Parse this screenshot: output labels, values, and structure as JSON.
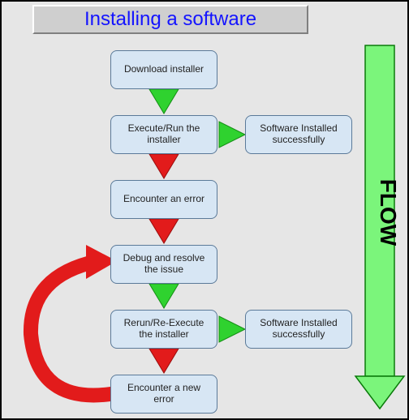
{
  "title": "Installing a software",
  "flow_label": "FLOW",
  "nodes": {
    "download": "Download installer",
    "execute": "Execute/Run the installer",
    "success1": "Software Installed successfully",
    "error1": "Encounter an error",
    "debug": "Debug and resolve the issue",
    "rerun": "Rerun/Re-Execute the installer",
    "success2": "Software Installed successfully",
    "error2": "Encounter a new error"
  },
  "colors": {
    "arrow_green": "#2fd22f",
    "arrow_red": "#e21b1b",
    "node_fill": "#d7e6f4",
    "node_border": "#5b7a99",
    "flow_arrow_fill": "#7bf57b",
    "flow_arrow_stroke": "#0a7a0a",
    "title_text": "#1414ff"
  }
}
